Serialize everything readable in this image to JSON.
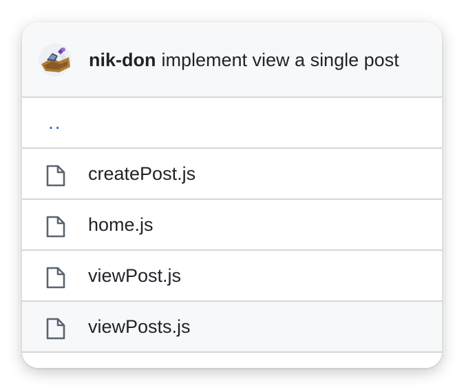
{
  "commit": {
    "author": "nik-don",
    "message": "implement view a single post"
  },
  "parent_link": "..",
  "files": [
    {
      "name": "createPost.js",
      "icon": "file-icon"
    },
    {
      "name": "home.js",
      "icon": "file-icon"
    },
    {
      "name": "viewPost.js",
      "icon": "file-icon"
    },
    {
      "name": "viewPosts.js",
      "icon": "file-icon"
    }
  ],
  "colors": {
    "link": "#0969da",
    "text": "#1f2328",
    "header_bg": "#f6f8fa",
    "border": "#d0d7de"
  }
}
